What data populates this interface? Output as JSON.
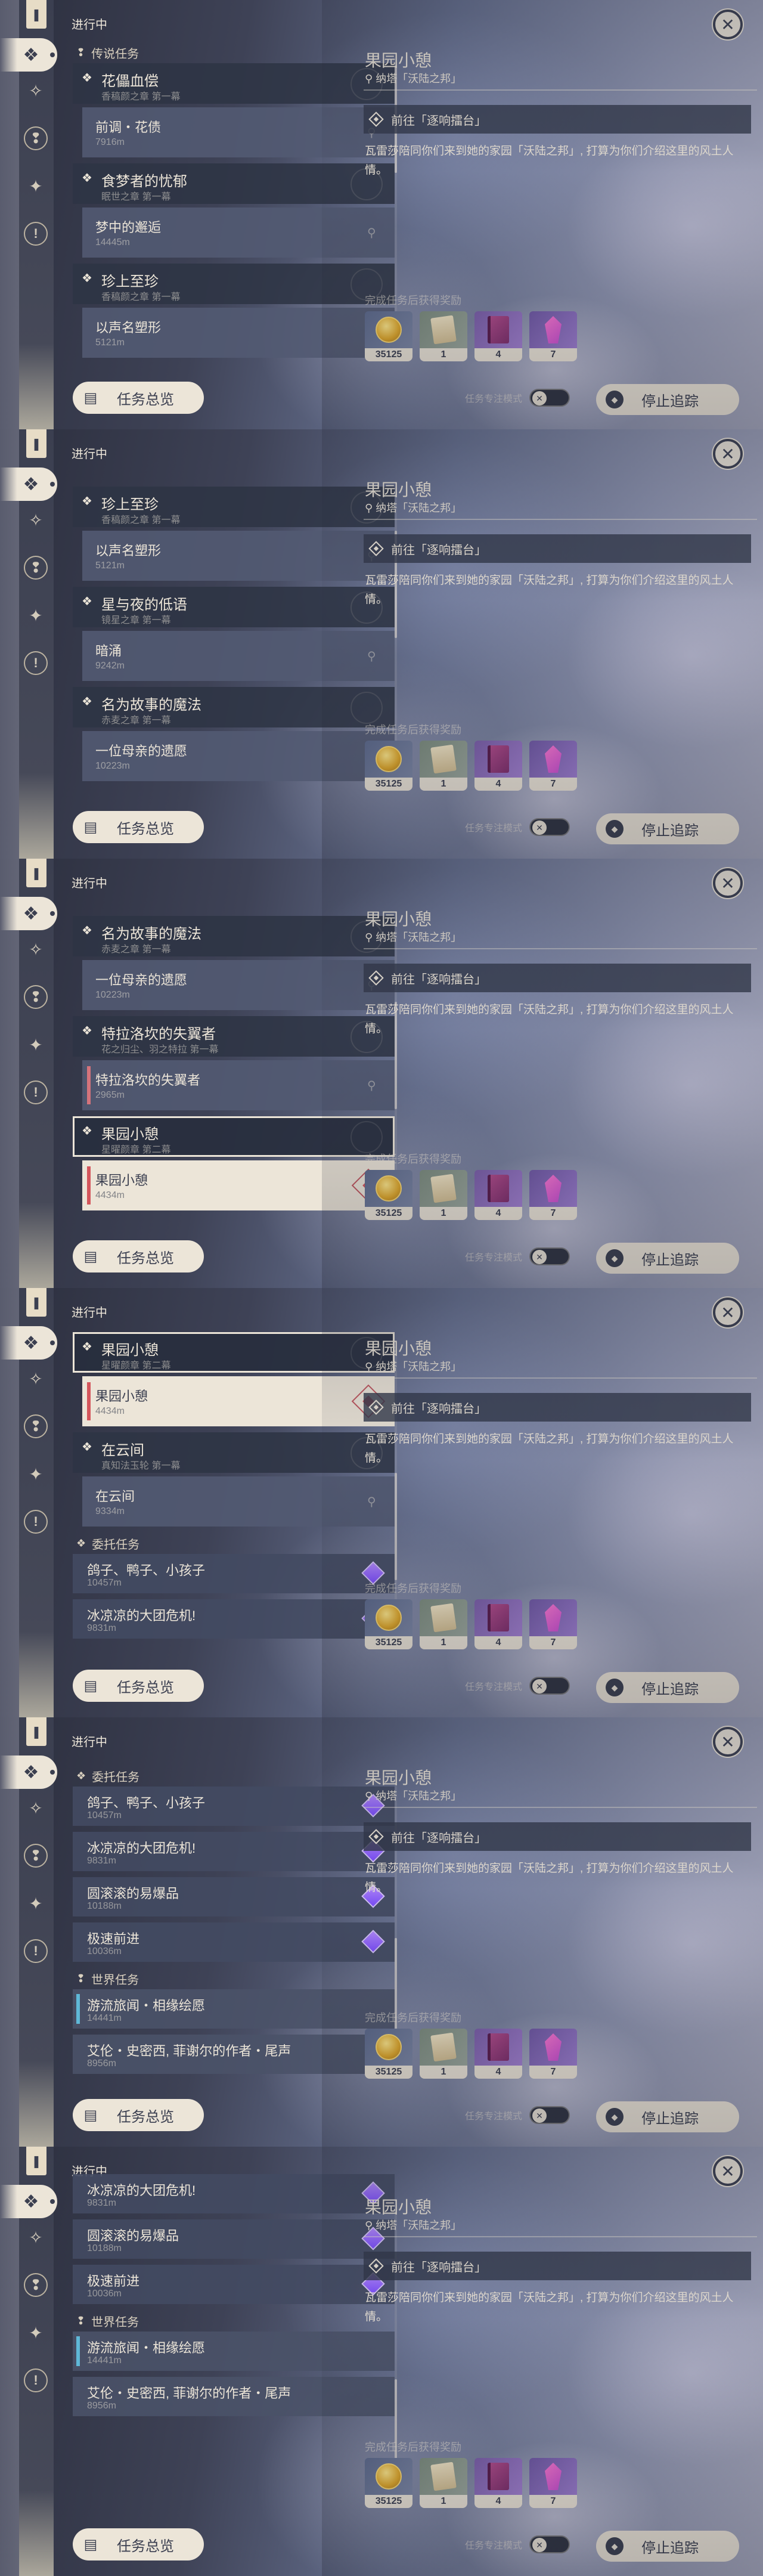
{
  "header_title": "进行中",
  "section_legend": "传说任务",
  "section_commission": "委托任务",
  "section_world": "世界任务",
  "quests": {
    "huazhi": {
      "name": "花儡血偿",
      "sub": "香稿颜之章 第一幕",
      "step": "前调・花债",
      "dist": "7916m"
    },
    "shimeng": {
      "name": "食梦者的忧郁",
      "sub": "眠世之章 第一幕",
      "step": "梦中的邂逅",
      "dist": "14445m"
    },
    "zhenzhen": {
      "name": "珍上至珍",
      "sub": "香稿颜之章 第一幕",
      "step": "以声名塑形",
      "dist": "5121m"
    },
    "xingye": {
      "name": "星与夜的低语",
      "sub": "镜星之章 第一幕",
      "step": "暗涌",
      "dist": "9242m"
    },
    "mingwei": {
      "name": "名为故事的魔法",
      "sub": "赤麦之章 第一幕",
      "step": "一位母亲的遗愿",
      "dist": "10223m"
    },
    "telu": {
      "name": "特拉洛坎的失翼者",
      "sub": "花之归尘、羽之特拉 第一幕",
      "step": "特拉洛坎的失翼者",
      "dist": "2965m"
    },
    "guoyuan": {
      "name": "果园小憩",
      "sub": "星曜颜章 第二幕",
      "step": "果园小憩",
      "dist": "4434m"
    },
    "zaiyun": {
      "name": "在云间",
      "sub": "真知法玉轮 第一幕",
      "step": "在云间",
      "dist": "9334m"
    }
  },
  "commissions": [
    {
      "name": "鸽子、鸭子、小孩子",
      "dist": "10457m"
    },
    {
      "name": "冰凉凉的大团危机!",
      "dist": "9831m"
    },
    {
      "name": "圆滚滚的易爆品",
      "dist": "10188m"
    },
    {
      "name": "极速前进",
      "dist": "10036m"
    }
  ],
  "world": [
    {
      "name": "游流旅闻・相缘绘愿",
      "dist": "14441m"
    },
    {
      "name": "艾伦・史密西, 菲谢尔的作者・尾声",
      "dist": "8956m"
    }
  ],
  "footer": {
    "overview": "任务总览",
    "toggle_label": "任务专注模式",
    "stop": "停止追踪"
  },
  "detail": {
    "title": "果园小憩",
    "location": "纳塔「沃陆之邦」",
    "objective": "前往「逐响擂台」",
    "description": "瓦雷莎陪同你们来到她的家园「沃陆之邦」, 打算为你们介绍这里的风土人情。",
    "rewards_label": "完成任务后获得奖励",
    "rewards": [
      {
        "icon": "mora-coin",
        "count": "35125"
      },
      {
        "icon": "scroll",
        "count": "1"
      },
      {
        "icon": "talent-book",
        "count": "4"
      },
      {
        "icon": "crystal",
        "count": "7"
      }
    ]
  }
}
